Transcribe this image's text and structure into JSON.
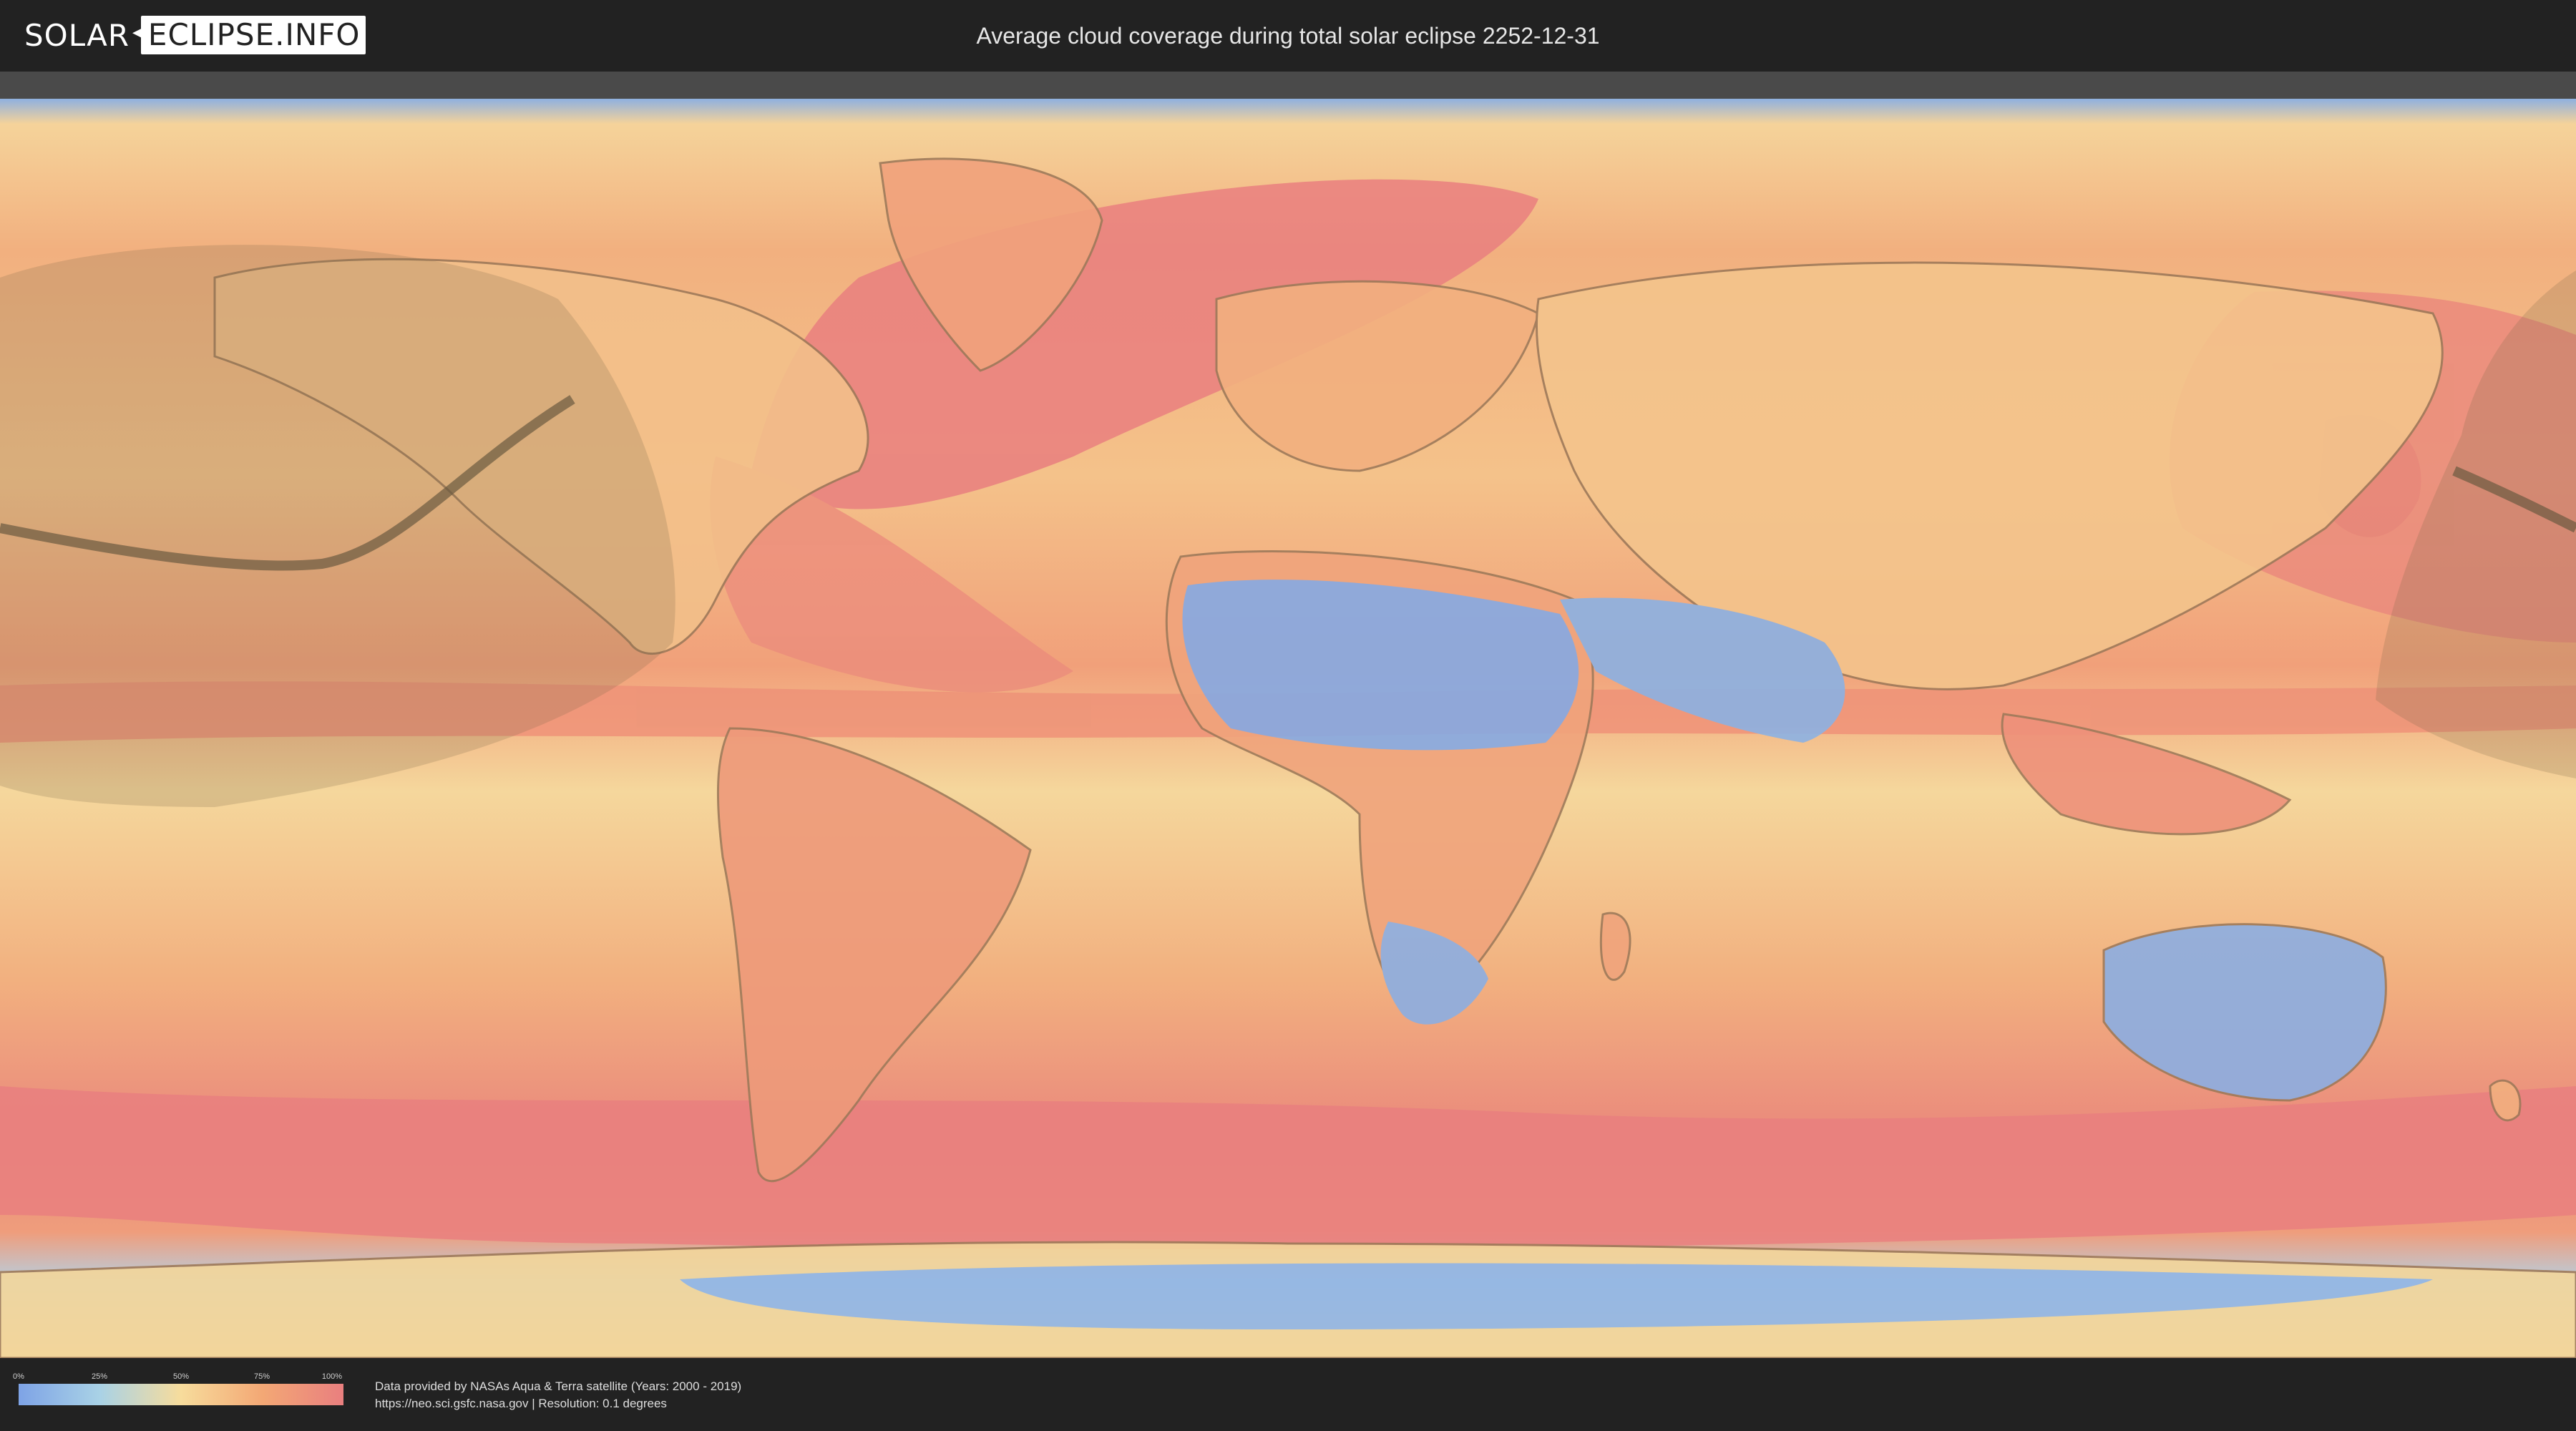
{
  "header": {
    "logo_part1": "SOLAR",
    "logo_part2": "ECLIPSE.INFO",
    "title": "Average cloud coverage during total solar eclipse 2252-12-31"
  },
  "legend": {
    "ticks": [
      "0%",
      "25%",
      "50%",
      "75%",
      "100%"
    ],
    "gradient_colors": [
      "#7ea3e6",
      "#a9d2e6",
      "#f7dc9c",
      "#f3a875",
      "#e97f7f"
    ]
  },
  "credits": {
    "line1": "Data provided by NASAs Aqua & Terra satellite (Years: 2000 - 2019)",
    "line2": "https://neo.sci.gsfc.nasa.gov | Resolution: 0.1 degrees"
  },
  "colors": {
    "cloudy_ocean": "#e97f7f",
    "moderate": "#f7dc9c",
    "clear": "#7ea3e6",
    "eclipse_zone": "#7a6a4a"
  }
}
